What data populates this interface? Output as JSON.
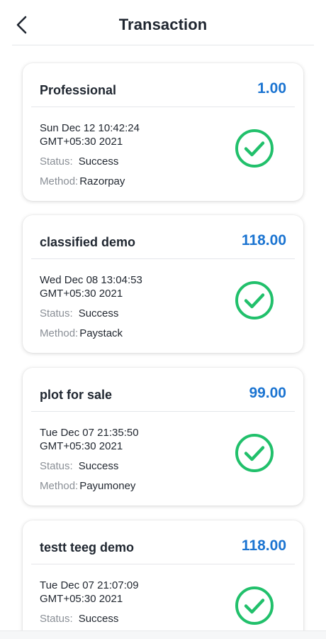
{
  "header": {
    "title": "Transaction",
    "back_icon": "chevron-left-icon"
  },
  "colors": {
    "amount": "#1b74d1",
    "success": "#21c06b",
    "muted_label": "#8a8f96"
  },
  "transactions": [
    {
      "title": "Professional",
      "amount": "1.00",
      "date_line1": "Sun Dec 12 10:42:24",
      "date_line2": "GMT+05:30 2021",
      "status_label": "Status:",
      "status": "Success",
      "method_label": "Method:",
      "method": "Razorpay",
      "status_icon": "check-circle-icon"
    },
    {
      "title": "classified demo",
      "amount": "118.00",
      "date_line1": "Wed Dec 08 13:04:53",
      "date_line2": "GMT+05:30 2021",
      "status_label": "Status:",
      "status": "Success",
      "method_label": "Method:",
      "method": "Paystack",
      "status_icon": "check-circle-icon"
    },
    {
      "title": "plot for sale",
      "amount": "99.00",
      "date_line1": "Tue Dec 07 21:35:50",
      "date_line2": "GMT+05:30 2021",
      "status_label": "Status:",
      "status": "Success",
      "method_label": "Method:",
      "method": "Payumoney",
      "status_icon": "check-circle-icon"
    },
    {
      "title": "testt teeg demo",
      "amount": "118.00",
      "date_line1": "Tue Dec 07 21:07:09",
      "date_line2": "GMT+05:30 2021",
      "status_label": "Status:",
      "status": "Success",
      "status_icon": "check-circle-icon"
    }
  ]
}
